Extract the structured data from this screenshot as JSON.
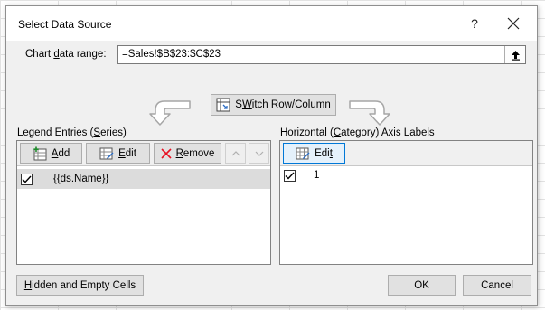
{
  "dialog": {
    "title": "Select Data Source",
    "help_label": "?",
    "close_label": "✕"
  },
  "range": {
    "label_pre": "Chart ",
    "label_accel": "d",
    "label_post": "ata range:",
    "value": "=Sales!$B$23:$C$23"
  },
  "switch": {
    "accel": "W",
    "rest": "Switch Row/Column",
    "pre": "S",
    "post": "itch Row/Column"
  },
  "legend": {
    "title_pre": "Legend Entries (",
    "title_accel": "S",
    "title_post": "eries)",
    "add_accel": "A",
    "add_rest": "dd",
    "edit_accel": "E",
    "edit_rest": "dit",
    "remove_accel": "R",
    "remove_rest": "emove",
    "items": [
      {
        "label": "{{ds.Name}}",
        "checked": true
      }
    ]
  },
  "axis": {
    "title_pre": "Horizontal (",
    "title_accel": "C",
    "title_post": "ategory) Axis Labels",
    "edit_pre": "Edi",
    "edit_accel": "t",
    "items": [
      {
        "label": "1",
        "checked": true
      }
    ]
  },
  "footer": {
    "hidden_accel": "H",
    "hidden_rest": "idden and Empty Cells",
    "ok_label": "OK",
    "cancel_label": "Cancel"
  },
  "colors": {
    "dialog_bg": "#f0f0f0",
    "button_bg": "#e1e1e1",
    "focus_border": "#0078d7",
    "remove_icon": "#e81123"
  }
}
